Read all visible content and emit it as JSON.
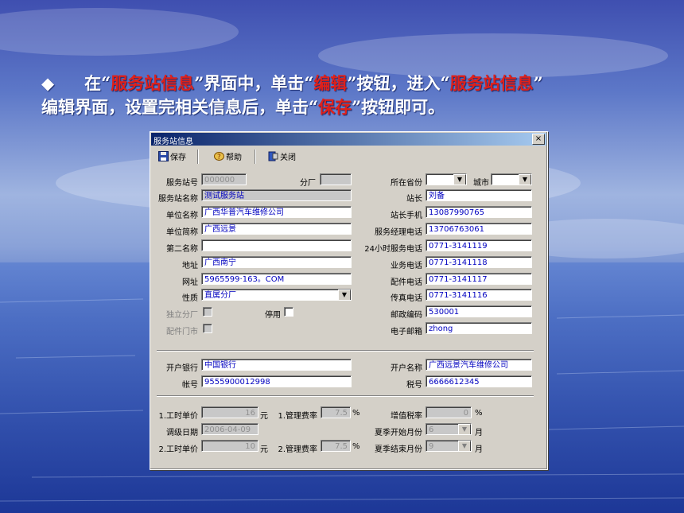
{
  "slide": {
    "bullet": "◆",
    "line1_pre": "在“",
    "r1": "服务站信息",
    "line1_mid": "”界面中，单击“",
    "r2": "编辑",
    "line1_mid2": "”按钮，进入“",
    "r3": "服务站信息",
    "line1_end": "”",
    "line2_pre": "编辑界面，设置完相关信息后，单击“",
    "r4": "保存",
    "line2_end": "”按钮即可。"
  },
  "dialog": {
    "title": "服务站信息",
    "close": "×",
    "toolbar": {
      "save": "保存",
      "help": "帮助",
      "close": "关闭"
    },
    "labels": {
      "station_no": "服务站号",
      "branch": "分厂",
      "province": "所在省份",
      "city": "城市",
      "station_name": "服务站名称",
      "master": "站长",
      "unit_name": "单位名称",
      "master_mobile": "站长手机",
      "unit_short": "单位简称",
      "manager_phone": "服务经理电话",
      "second_name": "第二名称",
      "phone24": "24小时服务电话",
      "address": "地址",
      "biz_phone": "业务电话",
      "website": "网址",
      "parts_phone": "配件电话",
      "nature": "性质",
      "fax": "传真电话",
      "independent_branch": "独立分厂",
      "disabled": "停用",
      "postcode": "邮政编码",
      "parts_store": "配件门市",
      "email": "电子邮箱",
      "bank": "开户银行",
      "account_name": "开户名称",
      "account_no": "帐号",
      "tax_no": "税号",
      "labor_price1": "1.工时单价",
      "mgmt_rate1": "1.管理费率",
      "vat_rate": "增值税率",
      "adjust_date": "调级日期",
      "summer_start": "夏季开始月份",
      "labor_price2": "2.工时单价",
      "mgmt_rate2": "2.管理费率",
      "summer_end": "夏季结束月份",
      "yuan": "元",
      "pct": "%",
      "month": "月"
    },
    "values": {
      "station_no": "000000",
      "branch": "",
      "province": "",
      "city": "",
      "station_name": "测试服务站",
      "master": "刘备",
      "unit_name": "广西华普汽车维修公司",
      "master_mobile": "13087990765",
      "unit_short": "广西远景",
      "manager_phone": "13706763061",
      "second_name": "",
      "phone24": "0771-3141119",
      "address": "广西南宁",
      "biz_phone": "0771-3141118",
      "website": "5965599·163。COM",
      "parts_phone": "0771-3141117",
      "nature": "直属分厂",
      "fax": "0771-3141116",
      "postcode": "530001",
      "email": "zhong",
      "bank": "中国银行",
      "account_name": "广西远景汽车维修公司",
      "account_no": "9555900012998",
      "tax_no": "6666612345",
      "labor_price1": "16",
      "mgmt_rate1": "7.5",
      "vat_rate": "0",
      "adjust_date": "2006-04-09",
      "summer_start": "6",
      "labor_price2": "10",
      "mgmt_rate2": "7.5",
      "summer_end": "9"
    }
  },
  "colors": {
    "accent_red": "#e0201a",
    "title_bar": "#0a246a",
    "value_text": "#0000c0"
  }
}
